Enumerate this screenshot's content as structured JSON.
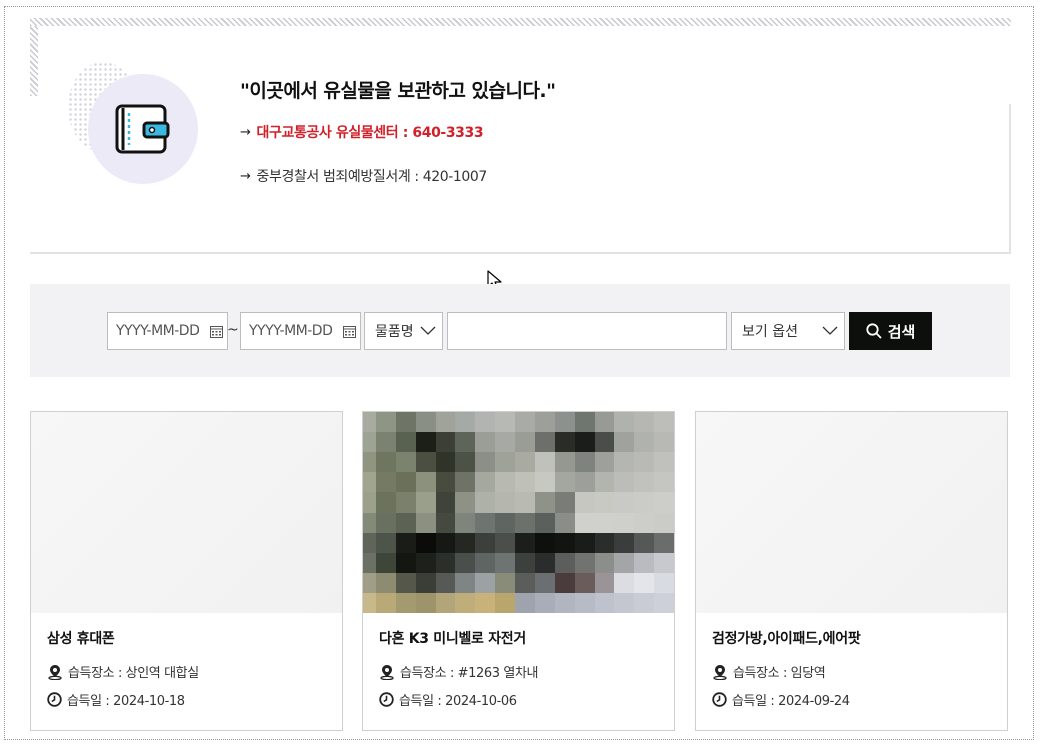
{
  "info": {
    "title": "\"이곳에서 유실물을 보관하고 있습니다.\"",
    "line1_arrow": "→",
    "line1": "대구교통공사 유실물센터 : 640-3333",
    "line2_arrow": "→",
    "line2": "중부경찰서 범죄예방질서계 : 420-1007",
    "icon": "wallet-icon"
  },
  "search": {
    "date_from_placeholder": "YYYY-MM-DD",
    "date_to_placeholder": "YYYY-MM-DD",
    "tilde": "~",
    "category_selected": "물품명",
    "keyword_value": "",
    "view_option_selected": "보기 옵션",
    "button_label": "검색"
  },
  "cards": [
    {
      "title": "삼성 휴대폰",
      "place": "습득장소 : 상인역 대합실",
      "date": "습득일 : 2024-10-18",
      "has_image": false
    },
    {
      "title": "다혼 K3 미니벨로 자전거",
      "place": "습득장소 : #1263 열차내",
      "date": "습득일 : 2024-10-06",
      "has_image": true
    },
    {
      "title": "검정가방,아이패드,에어팟",
      "place": "습득장소 : 임당역",
      "date": "습득일 : 2024-09-24",
      "has_image": false
    }
  ],
  "colors": {
    "accent_red": "#d0202a",
    "button_dark": "#0c0f0c",
    "search_bg": "#f2f2f4",
    "icon_circle": "#eceaf6",
    "icon_blue": "#3bb8e0"
  }
}
